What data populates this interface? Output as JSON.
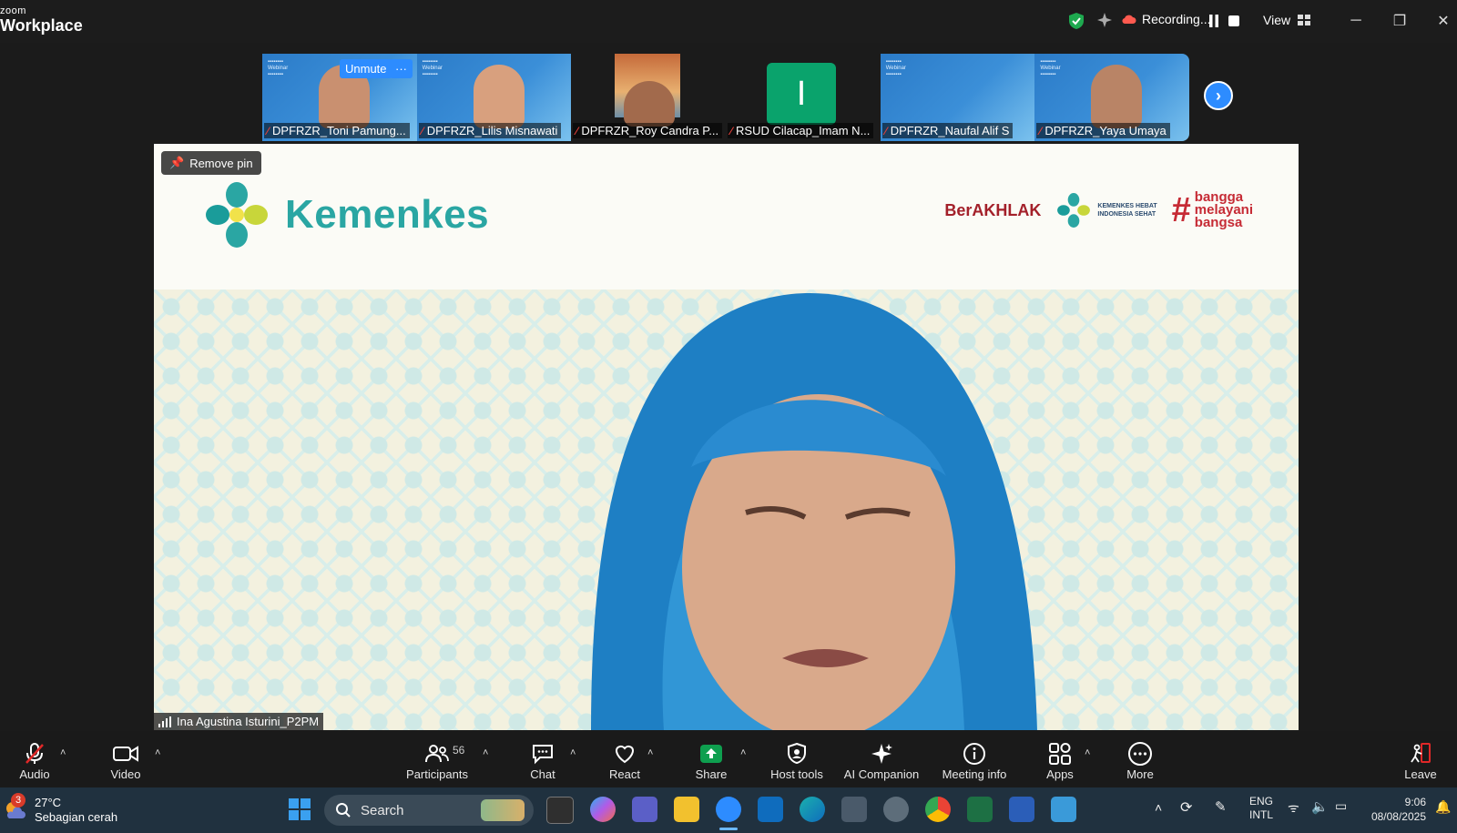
{
  "app": {
    "logo_top": "zoom",
    "logo_bottom": "Workplace"
  },
  "titlebar": {
    "recording_label": "Recording...",
    "view_label": "View"
  },
  "participants_strip": [
    {
      "name": "DPFRZR_Toni Pamung...",
      "style": "slide",
      "face_color": "#c99070"
    },
    {
      "name": "DPFRZR_Lilis Misnawati",
      "style": "slide",
      "face_color": "#d8a07e"
    },
    {
      "name": "DPFRZR_Roy Candra P...",
      "style": "dark",
      "face_color": "#a26a4c"
    },
    {
      "name": "RSUD Cilacap_Imam N...",
      "style": "avatar",
      "avatar_letter": "I"
    },
    {
      "name": "DPFRZR_Naufal Alif S",
      "style": "slide"
    },
    {
      "name": "DPFRZR_Yaya Umaya",
      "style": "slide",
      "face_color": "#b98466"
    }
  ],
  "strip_controls": {
    "unmute_label": "Unmute",
    "more_label": "···"
  },
  "main_video": {
    "remove_pin_label": "Remove pin",
    "brand": "Kemenkes",
    "logo_berakhlak": "BerAKHLAK",
    "logo_kemenkes_hebat_line1": "KEMENKES HEBAT",
    "logo_kemenkes_hebat_line2": "INDONESIA SEHAT",
    "logo_bangga_line1": "bangga",
    "logo_bangga_line2": "melayani",
    "logo_bangga_line3": "bangsa",
    "speaker_name": "Ina Agustina Isturini_P2PM"
  },
  "toolbar": {
    "audio": "Audio",
    "video": "Video",
    "participants": "Participants",
    "participants_count": "56",
    "chat": "Chat",
    "react": "React",
    "share": "Share",
    "host_tools": "Host tools",
    "ai_companion": "AI Companion",
    "meeting_info": "Meeting info",
    "apps": "Apps",
    "more": "More",
    "leave": "Leave"
  },
  "taskbar": {
    "weather_temp": "27°C",
    "weather_desc": "Sebagian cerah",
    "weather_badge": "3",
    "search_placeholder": "Search",
    "lang_line1": "ENG",
    "lang_line2": "INTL",
    "time": "9:06",
    "date": "08/08/2025"
  },
  "colors": {
    "zoom_blue": "#2d8cff",
    "share_green": "#0e9f4f",
    "leave_red": "#e02828",
    "kemenkes_teal": "#2aa6a3"
  }
}
